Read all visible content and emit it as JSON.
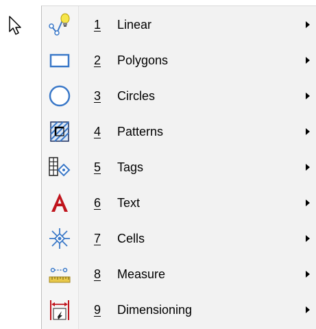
{
  "menu": {
    "items": [
      {
        "num": "1",
        "label": "Linear",
        "icon": "linear-bulb-icon"
      },
      {
        "num": "2",
        "label": "Polygons",
        "icon": "rectangle-icon"
      },
      {
        "num": "3",
        "label": "Circles",
        "icon": "circle-icon"
      },
      {
        "num": "4",
        "label": "Patterns",
        "icon": "hatch-pattern-icon"
      },
      {
        "num": "5",
        "label": "Tags",
        "icon": "tag-icon"
      },
      {
        "num": "6",
        "label": "Text",
        "icon": "text-a-icon"
      },
      {
        "num": "7",
        "label": "Cells",
        "icon": "cells-spark-icon"
      },
      {
        "num": "8",
        "label": "Measure",
        "icon": "measure-ruler-icon"
      },
      {
        "num": "9",
        "label": "Dimensioning",
        "icon": "dimensioning-icon"
      }
    ]
  },
  "colors": {
    "menu_bg": "#f2f2f2",
    "icon_blue": "#3a78c8",
    "text_red": "#c0141c"
  }
}
